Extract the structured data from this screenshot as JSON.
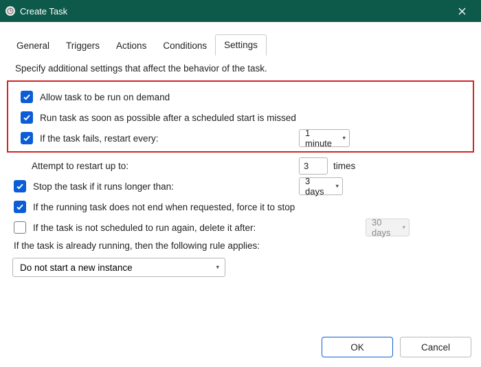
{
  "window": {
    "title": "Create Task"
  },
  "tabs": {
    "items": [
      "General",
      "Triggers",
      "Actions",
      "Conditions",
      "Settings"
    ],
    "active": "Settings"
  },
  "description": "Specify additional settings that affect the behavior of the task.",
  "settings": {
    "allow_on_demand": {
      "label": "Allow task to be run on demand"
    },
    "run_asap_missed": {
      "label": "Run task as soon as possible after a scheduled start is missed"
    },
    "restart_on_fail": {
      "label": "If the task fails, restart every:",
      "value": "1 minute"
    },
    "attempt_restart": {
      "label": "Attempt to restart up to:",
      "value": "3",
      "suffix": "times"
    },
    "stop_if_longer": {
      "label": "Stop the task if it runs longer than:",
      "value": "3 days"
    },
    "force_stop": {
      "label": "If the running task does not end when requested, force it to stop"
    },
    "delete_if_not_scheduled": {
      "label": "If the task is not scheduled to run again, delete it after:",
      "value": "30 days"
    },
    "rule_label": "If the task is already running, then the following rule applies:",
    "rule_value": "Do not start a new instance"
  },
  "buttons": {
    "ok": "OK",
    "cancel": "Cancel"
  }
}
